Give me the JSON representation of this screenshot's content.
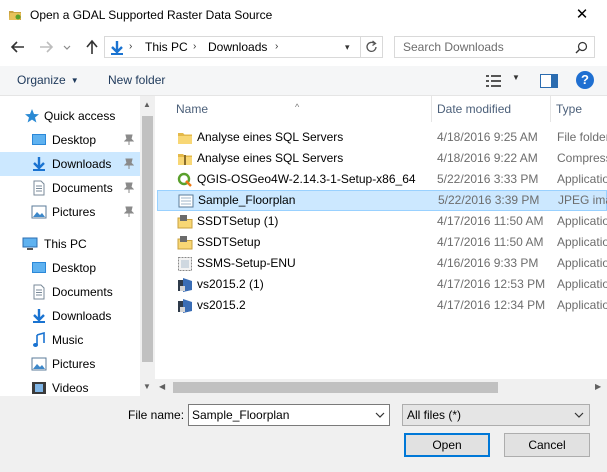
{
  "window": {
    "title": "Open a GDAL Supported Raster Data Source",
    "close_glyph": "✕"
  },
  "address_bar": {
    "crumbs": [
      "This PC",
      "Downloads"
    ],
    "separator": "›"
  },
  "search": {
    "placeholder": "Search Downloads"
  },
  "toolbar": {
    "organize_label": "Organize",
    "new_folder_label": "New folder",
    "help_glyph": "?"
  },
  "nav_pane": {
    "items": [
      {
        "label": "Quick access",
        "icon": "star-icon"
      },
      {
        "label": "Desktop",
        "icon": "desktop-folder-icon",
        "pinned": true
      },
      {
        "label": "Downloads",
        "icon": "downloads-icon",
        "pinned": true,
        "selected": true
      },
      {
        "label": "Documents",
        "icon": "documents-icon",
        "pinned": true
      },
      {
        "label": "Pictures",
        "icon": "pictures-icon",
        "pinned": true
      },
      {
        "label": "This PC",
        "icon": "computer-icon"
      },
      {
        "label": "Desktop",
        "icon": "desktop-folder-icon"
      },
      {
        "label": "Documents",
        "icon": "documents-icon"
      },
      {
        "label": "Downloads",
        "icon": "downloads-icon"
      },
      {
        "label": "Music",
        "icon": "music-icon"
      },
      {
        "label": "Pictures",
        "icon": "pictures-icon"
      },
      {
        "label": "Videos",
        "icon": "videos-icon"
      }
    ]
  },
  "file_list": {
    "columns": {
      "name": "Name",
      "date": "Date modified",
      "type": "Type"
    },
    "rows": [
      {
        "name": "Analyse eines SQL Servers",
        "date": "4/18/2016 9:25 AM",
        "type": "File folder",
        "icon": "folder-icon"
      },
      {
        "name": "Analyse eines SQL Servers",
        "date": "4/18/2016 9:22 AM",
        "type": "Compressed",
        "icon": "zip-folder-icon"
      },
      {
        "name": "QGIS-OSGeo4W-2.14.3-1-Setup-x86_64",
        "date": "5/22/2016 3:33 PM",
        "type": "Application",
        "icon": "qgis-icon"
      },
      {
        "name": "Sample_Floorplan",
        "date": "5/22/2016 3:39 PM",
        "type": "JPEG image",
        "icon": "image-icon",
        "selected": true
      },
      {
        "name": "SSDTSetup (1)",
        "date": "4/17/2016 11:50 AM",
        "type": "Application",
        "icon": "installer-icon"
      },
      {
        "name": "SSDTSetup",
        "date": "4/17/2016 11:50 AM",
        "type": "Application",
        "icon": "installer-icon"
      },
      {
        "name": "SSMS-Setup-ENU",
        "date": "4/16/2016 9:33 PM",
        "type": "Application",
        "icon": "setup-icon"
      },
      {
        "name": "vs2015.2 (1)",
        "date": "4/17/2016 12:53 PM",
        "type": "Application",
        "icon": "vs-icon"
      },
      {
        "name": "vs2015.2",
        "date": "4/17/2016 12:34 PM",
        "type": "Application",
        "icon": "vs-icon"
      }
    ]
  },
  "bottom": {
    "file_name_label": "File name:",
    "file_name_value": "Sample_Floorplan",
    "file_type_value": "All files (*)",
    "open_label": "Open",
    "cancel_label": "Cancel"
  },
  "colors": {
    "selection": "#cce8ff",
    "accent": "#0078d7",
    "folder": "#f8d775",
    "link_text": "#1e395b"
  }
}
